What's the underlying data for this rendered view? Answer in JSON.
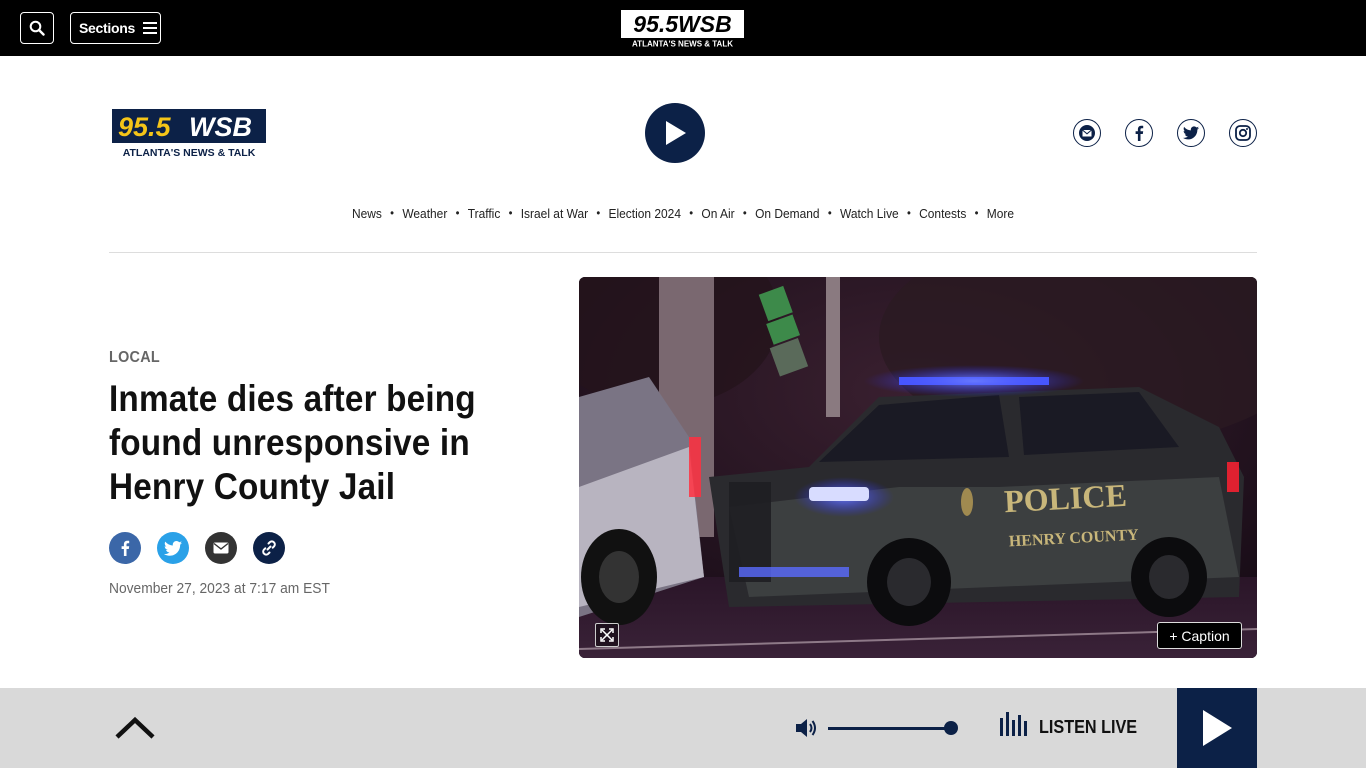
{
  "topbar": {
    "sections_label": "Sections",
    "logo_main": "95.5WSB",
    "logo_tagline": "ATLANTA'S NEWS & TALK"
  },
  "header": {
    "logo_main": "95.5WSB",
    "logo_number": "95.5",
    "logo_letters": "WSB",
    "logo_tagline": "ATLANTA'S NEWS & TALK"
  },
  "nav": {
    "items": [
      "News",
      "Weather",
      "Traffic",
      "Israel at War",
      "Election 2024",
      "On Air",
      "On Demand",
      "Watch Live",
      "Contests",
      "More"
    ]
  },
  "article": {
    "kicker": "LOCAL",
    "headline": "Inmate dies after being found unresponsive in Henry County Jail",
    "dateline": "November 27, 2023 at 7:17 am EST",
    "caption_label": "+  Caption",
    "photo_text_police": "POLICE",
    "photo_text_county": "HENRY COUNTY"
  },
  "player": {
    "listen_label": "LISTEN LIVE",
    "volume_level": 1.0
  },
  "colors": {
    "brand_navy": "#0c2147",
    "logo_yellow": "#f5c518",
    "facebook": "#3b67a8",
    "twitter": "#2aa1e8",
    "email": "#333333",
    "link": "#0c2147"
  }
}
